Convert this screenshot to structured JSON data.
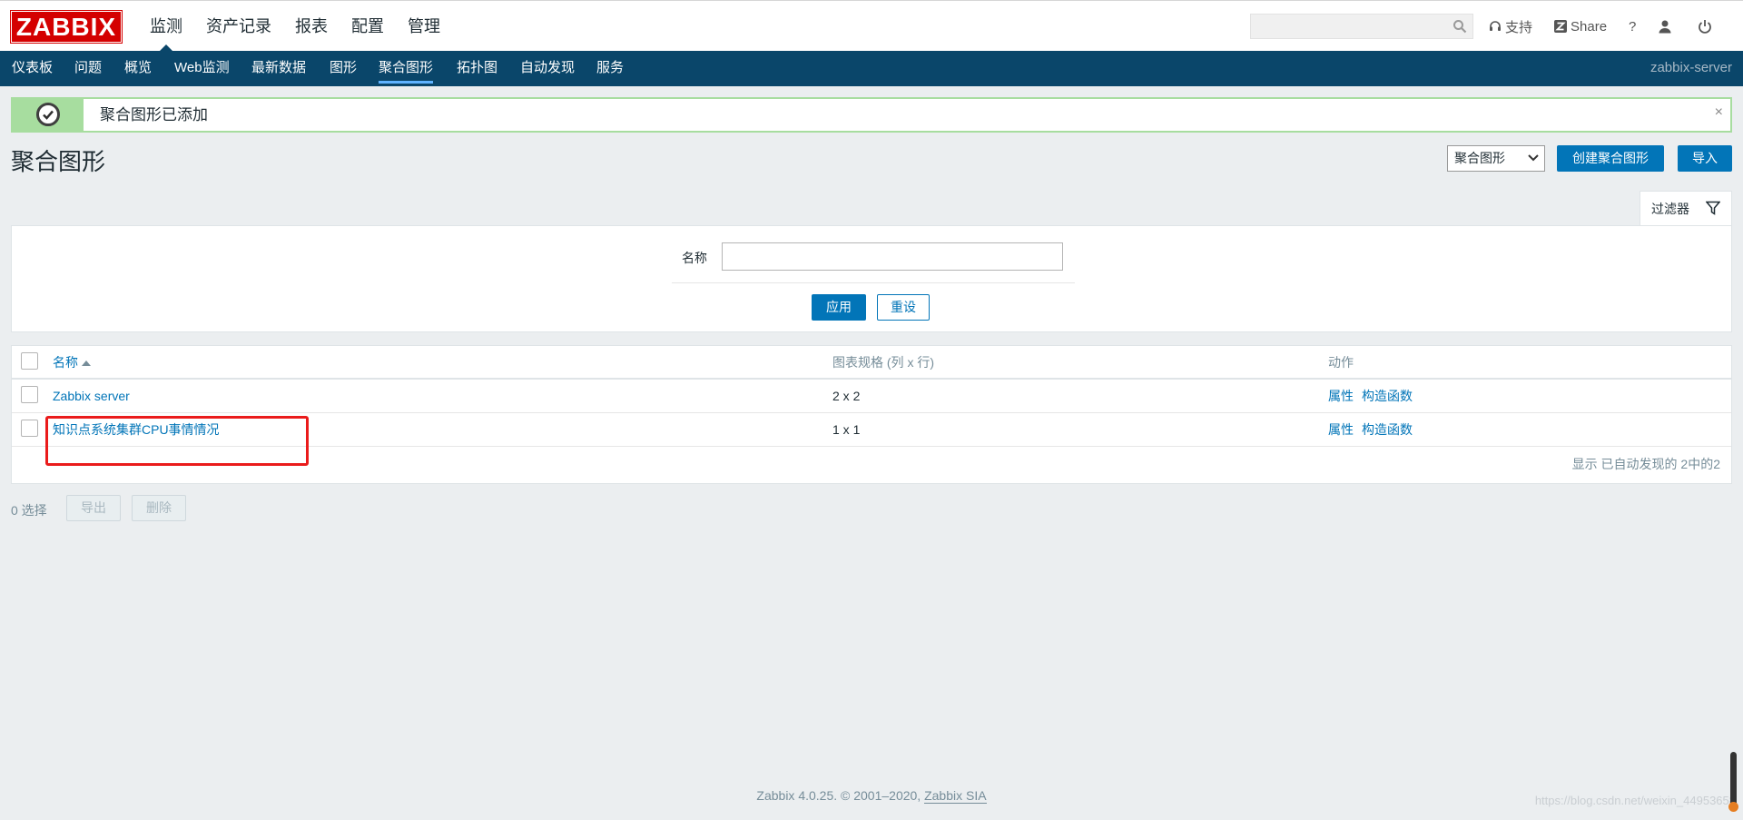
{
  "header": {
    "logo": "ZABBIX",
    "menu": [
      "监测",
      "资产记录",
      "报表",
      "配置",
      "管理"
    ],
    "search_placeholder": "",
    "support": "支持",
    "share": "Share",
    "help": "?"
  },
  "subnav": {
    "items": [
      "仪表板",
      "问题",
      "概览",
      "Web监测",
      "最新数据",
      "图形",
      "聚合图形",
      "拓扑图",
      "自动发现",
      "服务"
    ],
    "active": "聚合图形",
    "server": "zabbix-server"
  },
  "message": {
    "text": "聚合图形已添加",
    "close": "×"
  },
  "page": {
    "title": "聚合图形",
    "view_select": "聚合图形",
    "create_button": "创建聚合图形",
    "import_button": "导入"
  },
  "filter": {
    "tab_label": "过滤器",
    "name_label": "名称",
    "name_value": "",
    "apply": "应用",
    "reset": "重设"
  },
  "table": {
    "headers": {
      "name": "名称",
      "size": "图表规格 (列 x 行)",
      "actions": "动作"
    },
    "rows": [
      {
        "name": "Zabbix server",
        "size": "2 x 2",
        "properties": "属性",
        "constructor": "构造函数"
      },
      {
        "name": "知识点系统集群CPU事情情况",
        "size": "1 x 1",
        "properties": "属性",
        "constructor": "构造函数"
      }
    ],
    "display": "显示 已自动发现的 2中的2"
  },
  "actions": {
    "selected": "0 选择",
    "export": "导出",
    "delete": "删除"
  },
  "footer": {
    "text": "Zabbix 4.0.25. © 2001–2020, ",
    "company": "Zabbix SIA"
  },
  "watermark": "https://blog.csdn.net/weixin_44953658",
  "colors": {
    "nav": "#0a466a",
    "primary": "#0275b8",
    "success": "#a7dd9f",
    "logo": "#d40000"
  }
}
